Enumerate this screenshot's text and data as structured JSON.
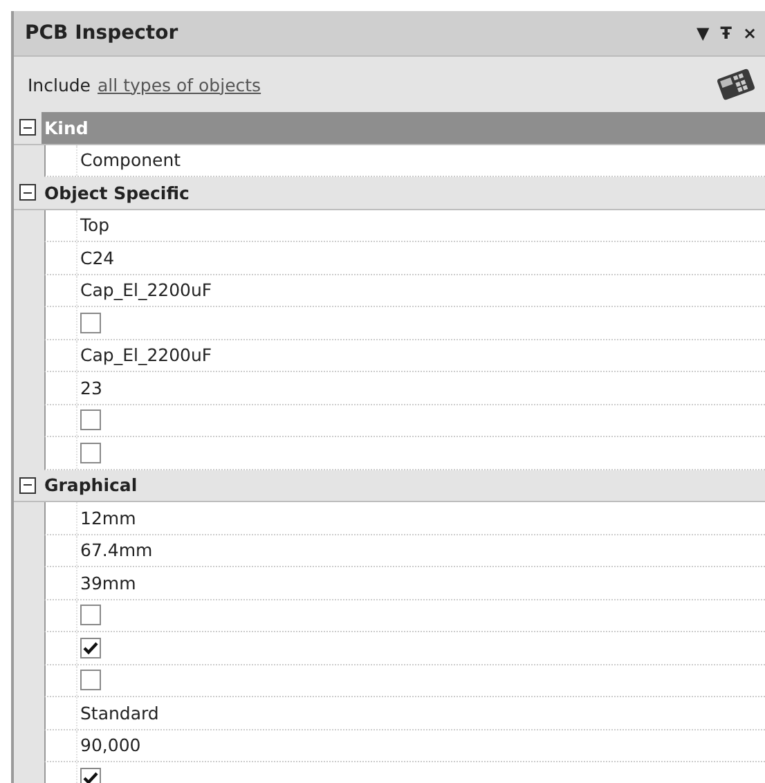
{
  "window": {
    "title": "PCB Inspector",
    "controls": [
      "▼",
      "Ŧ",
      "×"
    ]
  },
  "include": {
    "label": "Include",
    "link": "all types of objects"
  },
  "sections": [
    {
      "title": "Kind",
      "expanded": true,
      "selected": true,
      "rows": [
        {
          "kind": "text",
          "value": "Component"
        }
      ]
    },
    {
      "title": "Object Specific",
      "expanded": true,
      "selected": false,
      "rows": [
        {
          "kind": "text",
          "value": "Top"
        },
        {
          "kind": "text",
          "value": "C24"
        },
        {
          "kind": "text",
          "value": "Cap_El_2200uF"
        },
        {
          "kind": "checkbox",
          "checked": false
        },
        {
          "kind": "text",
          "value": "Cap_El_2200uF"
        },
        {
          "kind": "text",
          "value": "23"
        },
        {
          "kind": "checkbox",
          "checked": false
        },
        {
          "kind": "checkbox",
          "checked": false
        }
      ]
    },
    {
      "title": "Graphical",
      "expanded": true,
      "selected": false,
      "rows": [
        {
          "kind": "text",
          "value": "12mm"
        },
        {
          "kind": "text",
          "value": "67.4mm"
        },
        {
          "kind": "text",
          "value": "39mm"
        },
        {
          "kind": "checkbox",
          "checked": false
        },
        {
          "kind": "checkbox",
          "checked": true
        },
        {
          "kind": "checkbox",
          "checked": false
        },
        {
          "kind": "text",
          "value": "Standard"
        },
        {
          "kind": "text",
          "value": "90,000"
        },
        {
          "kind": "checkbox",
          "checked": true
        }
      ]
    }
  ]
}
